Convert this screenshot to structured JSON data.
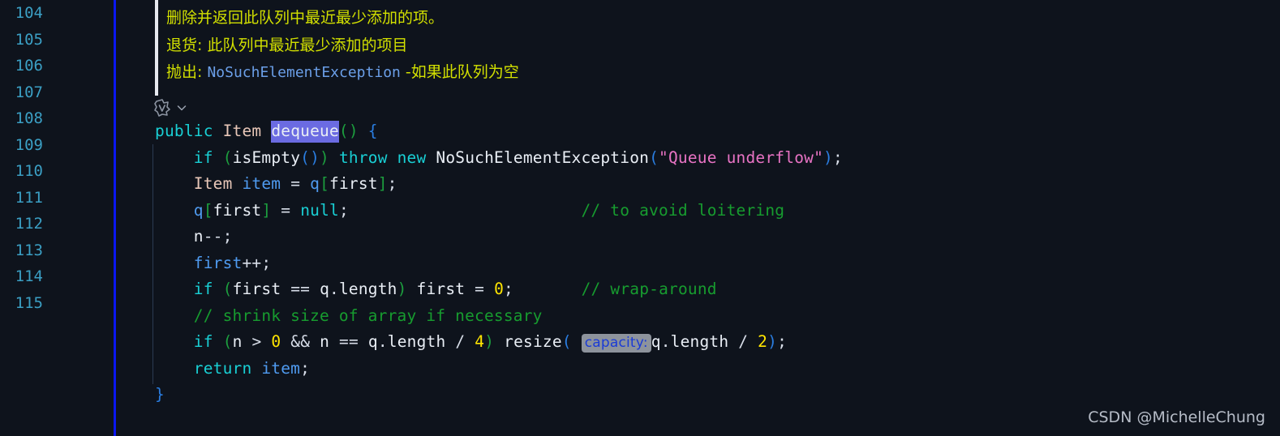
{
  "editor": {
    "background": "#0e131c",
    "gutter_rule_color": "#0a17f0",
    "linenumber_color": "#3b9fc4"
  },
  "gutter": {
    "line_numbers": [
      "104",
      "105",
      "106",
      "107",
      "108",
      "109",
      "110",
      "111",
      "112",
      "113",
      "114",
      "115"
    ]
  },
  "javadoc": {
    "summary": "删除并返回此队列中最近最少添加的项。",
    "returns_label": "退货:",
    "returns_text": "此队列中最近最少添加的项目",
    "throws_label": "抛出:",
    "throws_type": "NoSuchElementException",
    "throws_text": "-如果此队列为空",
    "text_color": "#d2e000",
    "type_color": "#6b9fe8",
    "border_color": "#e6e9ef"
  },
  "codelens": {
    "icon": "code-lens-icon",
    "chevron": "chevron-down-icon"
  },
  "code": {
    "selection_color": "#6b6be2",
    "inlay_hint_background": "#8d939c",
    "inlay_hint_color": "#1a3bd6",
    "selected_token": "dequeue",
    "inlay_hint_text": "capacity:",
    "lines": [
      {
        "number": "104",
        "text": "public Item dequeue() {"
      },
      {
        "number": "105",
        "text": "    if (isEmpty()) throw new NoSuchElementException(\"Queue underflow\");"
      },
      {
        "number": "106",
        "text": "    Item item = q[first];"
      },
      {
        "number": "107",
        "text": "    q[first] = null;                        // to avoid loitering"
      },
      {
        "number": "108",
        "text": "    n--;"
      },
      {
        "number": "109",
        "text": "    first++;"
      },
      {
        "number": "110",
        "text": "    if (first == q.length) first = 0;       // wrap-around"
      },
      {
        "number": "111",
        "text": "    // shrink size of array if necessary"
      },
      {
        "number": "112",
        "text": "    if (n > 0 && n == q.length / 4) resize( capacity: q.length / 2);"
      },
      {
        "number": "113",
        "text": "    return item;"
      },
      {
        "number": "114",
        "text": "}"
      },
      {
        "number": "115",
        "text": ""
      }
    ],
    "tokens": {
      "kw_public": "public",
      "type_Item": "Item",
      "method_dequeue": "dequeue",
      "kw_if": "if",
      "call_isEmpty": "isEmpty",
      "kw_throw": "throw",
      "kw_new": "new",
      "class_exception": "NoSuchElementException",
      "string_underflow": "\"Queue underflow\"",
      "var_item": "item",
      "var_q": "q",
      "var_first": "first",
      "kw_null": "null",
      "var_n": "n",
      "prop_length": "length",
      "call_resize": "resize",
      "kw_return": "return",
      "num_0": "0",
      "num_4": "4",
      "num_2": "2",
      "comment_loitering": "// to avoid loitering",
      "comment_wrap": "// wrap-around",
      "comment_shrink": "// shrink size of array if necessary"
    }
  },
  "watermark": {
    "text": "CSDN @MichelleChung"
  }
}
